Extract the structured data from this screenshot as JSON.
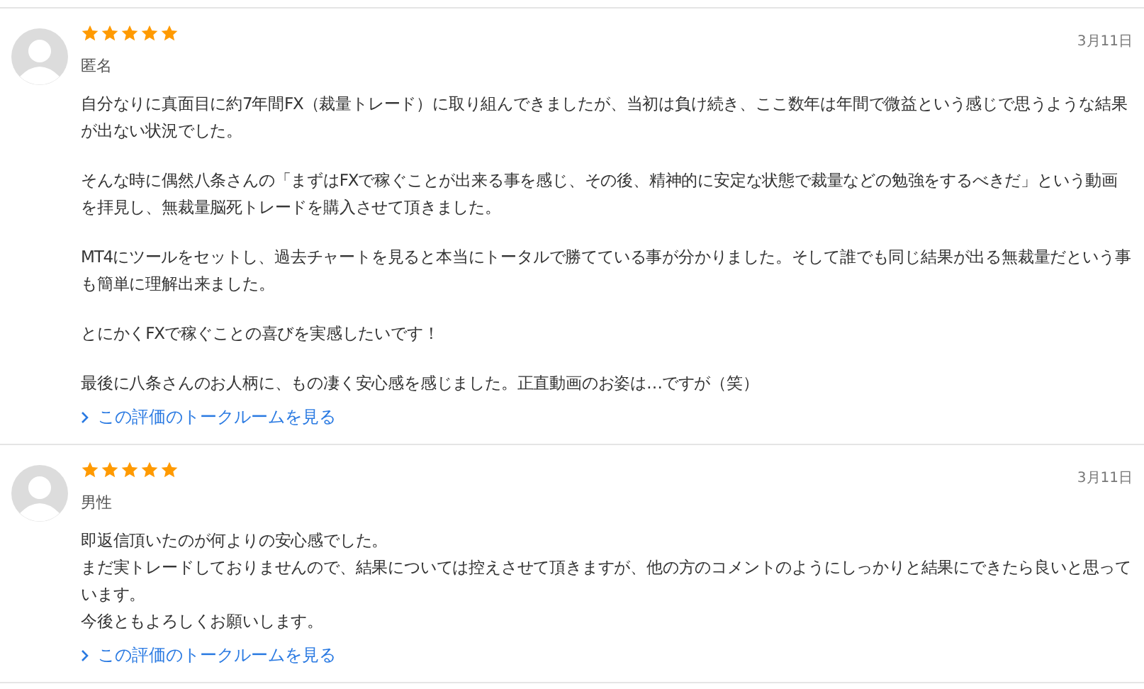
{
  "reviews": [
    {
      "stars": 5,
      "author": "匿名",
      "date": "3月11日",
      "paragraphs": [
        [
          "自分なりに真面目に約7年間FX（裁量トレード）に取り組んできましたが、当初は負け続き、ここ数年は年間で微益という感じで思うような結果が出ない状況でした。"
        ],
        [
          "そんな時に偶然八条さんの「まずはFXで稼ぐことが出来る事を感じ、その後、精神的に安定な状態で裁量などの勉強をするべきだ」という動画を拝見し、無裁量脳死トレードを購入させて頂きました。"
        ],
        [
          "MT4にツールをセットし、過去チャートを見ると本当にトータルで勝てている事が分かりました。そして誰でも同じ結果が出る無裁量だという事も簡単に理解出来ました。"
        ],
        [
          "とにかくFXで稼ぐことの喜びを実感したいです！"
        ],
        [
          "最後に八条さんのお人柄に、もの凄く安心感を感じました。正直動画のお姿は…ですが（笑）"
        ]
      ],
      "link": "この評価のトークルームを見る"
    },
    {
      "stars": 5,
      "author": "男性",
      "date": "3月11日",
      "paragraphs": [
        [
          "即返信頂いたのが何よりの安心感でした。",
          "まだ実トレードしておりませんので、結果については控えさせて頂きますが、他の方のコメントのようにしっかりと結果にできたら良いと思っています。",
          "今後ともよろしくお願いします。"
        ]
      ],
      "link": "この評価のトークルームを見る"
    }
  ]
}
